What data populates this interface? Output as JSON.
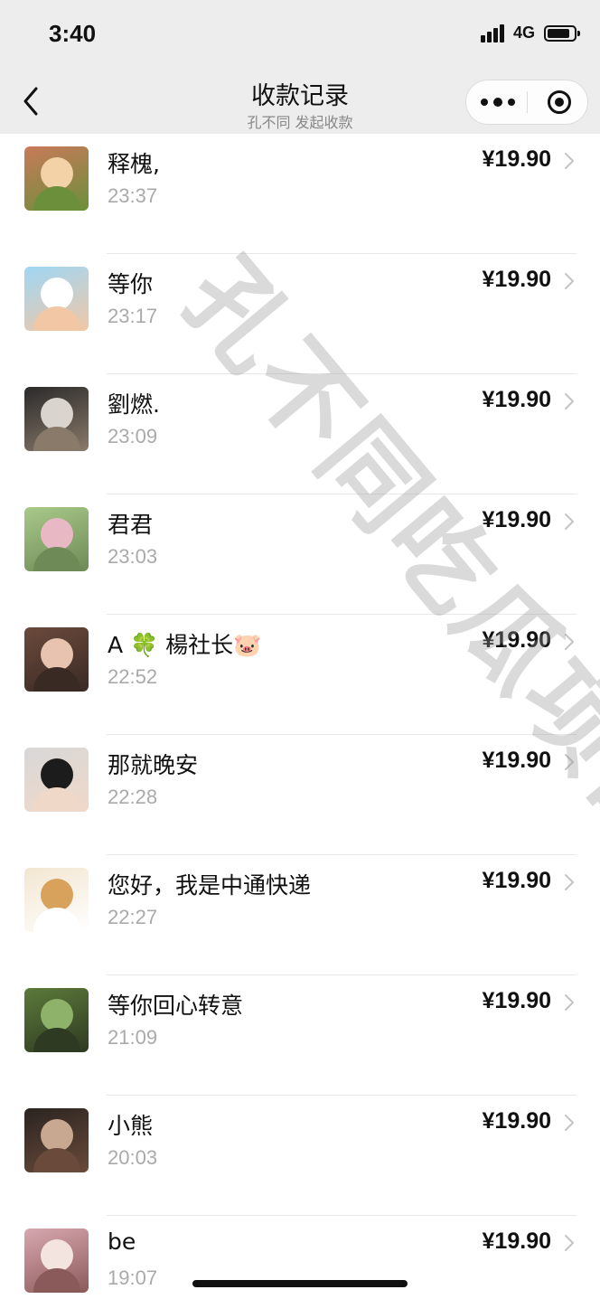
{
  "status_bar": {
    "time": "3:40",
    "network": "4G"
  },
  "nav": {
    "title": "收款记录",
    "subtitle": "孔不同 发起收款"
  },
  "records": [
    {
      "name": "释槐,",
      "time": "23:37",
      "amount": "¥19.90",
      "avatar_colors": [
        "#c97a5a",
        "#f3d2a8",
        "#6b8f3a"
      ]
    },
    {
      "name": "等你",
      "time": "23:17",
      "amount": "¥19.90",
      "avatar_colors": [
        "#9fd7f5",
        "#ffffff",
        "#f1c7a5"
      ]
    },
    {
      "name": "劉燃.",
      "time": "23:09",
      "amount": "¥19.90",
      "avatar_colors": [
        "#2a2a2a",
        "#d9d4ce",
        "#8a7a6a"
      ]
    },
    {
      "name": "君君",
      "time": "23:03",
      "amount": "¥19.90",
      "avatar_colors": [
        "#a9c98a",
        "#e8b8c4",
        "#6e8a56"
      ]
    },
    {
      "name": "A 🍀 楊社长🐷",
      "time": "22:52",
      "amount": "¥19.90",
      "avatar_colors": [
        "#6b4a3c",
        "#e8c4b0",
        "#3a2a24"
      ]
    },
    {
      "name": "那就晚安",
      "time": "22:28",
      "amount": "¥19.90",
      "avatar_colors": [
        "#d8d8d8",
        "#1c1c1c",
        "#f0d8c8"
      ]
    },
    {
      "name": "您好，我是中通快递",
      "time": "22:27",
      "amount": "¥19.90",
      "avatar_colors": [
        "#f2e6d0",
        "#d9a25c",
        "#ffffff"
      ]
    },
    {
      "name": "等你回心转意",
      "time": "21:09",
      "amount": "¥19.90",
      "avatar_colors": [
        "#5c7a3a",
        "#8fb26a",
        "#2e3a22"
      ]
    },
    {
      "name": "小熊",
      "time": "20:03",
      "amount": "¥19.90",
      "avatar_colors": [
        "#2a2420",
        "#c8a890",
        "#6a4a3a"
      ]
    },
    {
      "name": "be",
      "time": "19:07",
      "amount": "¥19.90",
      "avatar_colors": [
        "#d8a8b0",
        "#f4e4e0",
        "#8a5a5a"
      ]
    }
  ],
  "watermark": "孔不同吃瓜项目",
  "colors": {
    "background": "#ffffff",
    "header": "#ededed",
    "primary_text": "#111111",
    "secondary_text": "#aaaaaa",
    "divider": "#e8e8e8"
  }
}
